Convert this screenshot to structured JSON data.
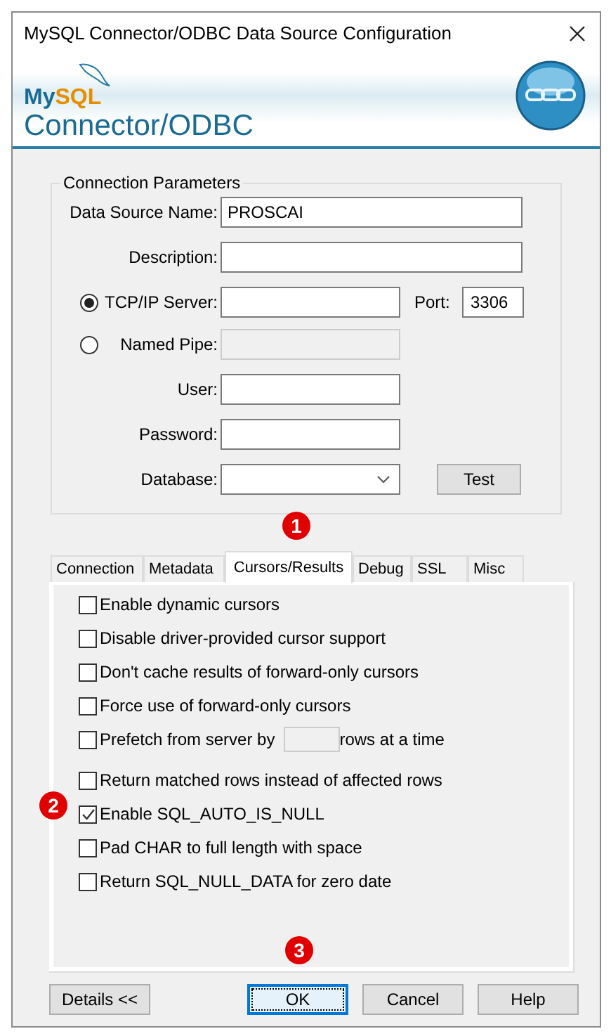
{
  "window": {
    "title": "MySQL Connector/ODBC Data Source Configuration"
  },
  "banner": {
    "brand_prefix": "My",
    "brand_suffix": "SQL",
    "product": "Connector/ODBC"
  },
  "connection_parameters": {
    "title": "Connection Parameters",
    "fields": [
      {
        "kind": "text",
        "label": "Data Source Name:",
        "value": "PROSCAI"
      },
      {
        "kind": "text",
        "label": "Description:"
      },
      {
        "kind": "radio",
        "label": "TCP/IP Server:",
        "selected": true,
        "disabled": false,
        "port_label": "Port:",
        "port_value": "3306"
      },
      {
        "kind": "radio",
        "label": "Named Pipe:",
        "selected": false,
        "disabled": true
      },
      {
        "kind": "short",
        "label": "User:"
      },
      {
        "kind": "short",
        "label": "Password:"
      },
      {
        "kind": "dropdown",
        "label": "Database:",
        "button": "Test"
      }
    ]
  },
  "tabs": [
    {
      "label": "Connection",
      "selected": false
    },
    {
      "label": "Metadata",
      "selected": false
    },
    {
      "label": "Cursors/Results",
      "selected": true
    },
    {
      "label": "Debug",
      "selected": false
    },
    {
      "label": "SSL",
      "selected": false
    },
    {
      "label": "Misc",
      "selected": false
    }
  ],
  "options": [
    {
      "kind": "checkbox",
      "label": "Enable dynamic cursors",
      "checked": false
    },
    {
      "kind": "checkbox",
      "label": "Disable driver-provided cursor support",
      "checked": false
    },
    {
      "kind": "checkbox",
      "label": "Don't cache results of forward-only cursors",
      "checked": false
    },
    {
      "kind": "checkbox",
      "label": "Force use of forward-only cursors",
      "checked": false
    },
    {
      "kind": "prefetch",
      "label": "Prefetch from server by",
      "suffix": "rows at a time",
      "checked": false
    },
    {
      "kind": "checkbox",
      "label": "Return matched rows instead of affected rows",
      "checked": false
    },
    {
      "kind": "checkbox",
      "label": "Enable SQL_AUTO_IS_NULL",
      "checked": true
    },
    {
      "kind": "checkbox",
      "label": "Pad CHAR to full length with space",
      "checked": false
    },
    {
      "kind": "checkbox",
      "label": "Return SQL_NULL_DATA for zero date",
      "checked": false
    }
  ],
  "buttons": [
    {
      "label": "Details <<",
      "focused": false
    },
    {
      "label": "OK",
      "focused": true
    },
    {
      "label": "Cancel",
      "focused": false
    },
    {
      "label": "Help",
      "focused": false
    }
  ],
  "callouts": [
    {
      "number": "1"
    },
    {
      "number": "2"
    },
    {
      "number": "3"
    }
  ]
}
